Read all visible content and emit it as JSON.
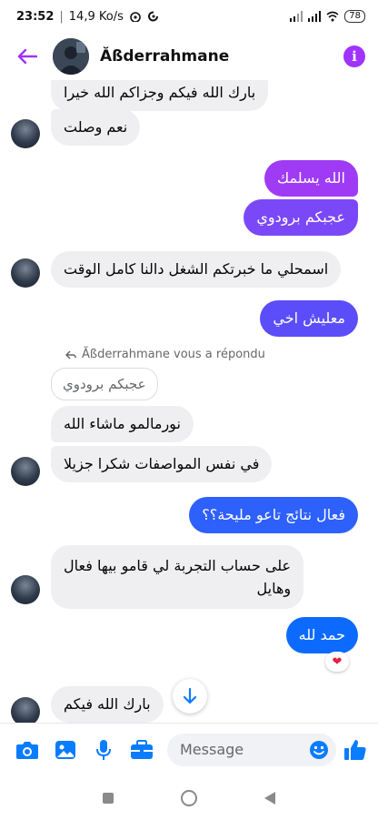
{
  "status_bar": {
    "time": "23:52",
    "speed": "14,9 Ko/s",
    "battery": "78"
  },
  "header": {
    "contact_name": "Ăßderrahmane"
  },
  "messages": [
    {
      "side": "in",
      "text": "بارك الله فيكم وجزاكم الله خيرا"
    },
    {
      "side": "in",
      "text": "نعم وصلت"
    },
    {
      "side": "out",
      "text": "الله يسلمك"
    },
    {
      "side": "out",
      "text": "عجبكم برودوي"
    },
    {
      "side": "in",
      "text": "اسمحلي ما خبرتكم الشغل دالنا كامل الوقت"
    },
    {
      "side": "out",
      "text": "معليش اخي"
    },
    {
      "side": "in",
      "text": "نورمالمو ماشاء الله"
    },
    {
      "side": "in",
      "text": "في نفس المواصفات شكرا جزيلا"
    },
    {
      "side": "out",
      "text": "فعال نتائج تاعو مليحة؟؟"
    },
    {
      "side": "in",
      "text": "على حساب التجربة لي قامو بيها فعال"
    },
    {
      "side": "in",
      "text": "وهايل"
    },
    {
      "side": "out",
      "text": "حمد لله"
    },
    {
      "side": "in",
      "text": "بارك الله فيكم"
    }
  ],
  "reply": {
    "note": "Ăßderrahmane vous a répondu",
    "quoted_text": "عجبكم برودوي"
  },
  "reaction": {
    "emoji": "❤"
  },
  "composer": {
    "placeholder": "Message"
  },
  "colors": {
    "accent": "#a033ff",
    "out_bubble_top": "#a033ff",
    "out_bubble_mid": "#5a4cff",
    "out_bubble_bottom": "#0a6cff",
    "in_bubble": "#efeff1",
    "icon_blue": "#0a7cff"
  },
  "icons": [
    "back-arrow-icon",
    "info-icon",
    "camera-icon",
    "image-icon",
    "microphone-icon",
    "briefcase-icon",
    "emoji-icon",
    "like-icon",
    "reply-icon",
    "chevron-down-icon"
  ]
}
